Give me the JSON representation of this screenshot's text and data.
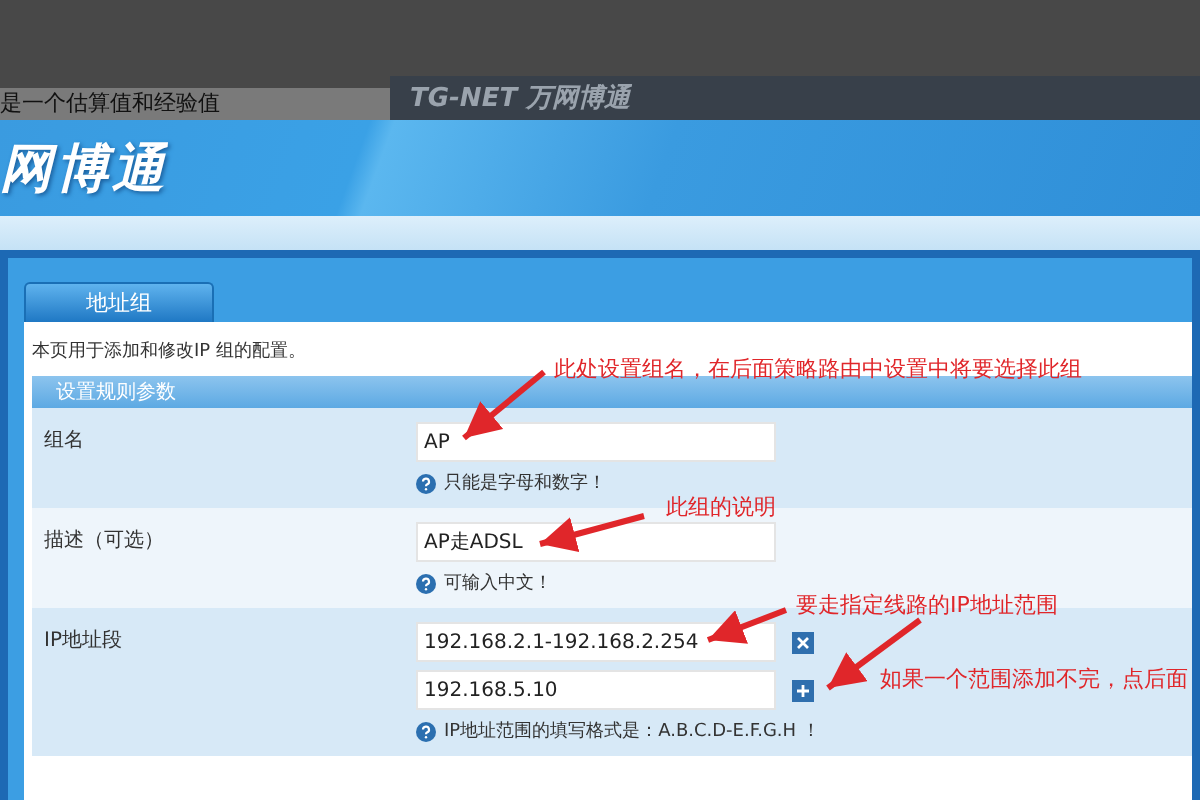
{
  "top_bar": {
    "caption": "是一个估算值和经验值",
    "brand": "TG-NET 万网博通"
  },
  "header": {
    "logo": "网博通"
  },
  "tabs": [
    {
      "label": "地址组",
      "selected": true
    }
  ],
  "description": "本页用于添加和修改IP 组的配置。",
  "section": {
    "title": "设置规则参数"
  },
  "rows": [
    {
      "label": "组名",
      "fields": [
        {
          "value": "AP"
        }
      ],
      "hint": "只能是字母和数字！"
    },
    {
      "label": "描述（可选）",
      "fields": [
        {
          "value": "AP走ADSL"
        }
      ],
      "hint": "可输入中文！"
    },
    {
      "label": "IP地址段",
      "fields": [
        {
          "value": "192.168.2.1-192.168.2.254",
          "kind": "removable"
        },
        {
          "value": "192.168.5.10",
          "kind": "addable"
        }
      ],
      "hint": "IP地址范围的填写格式是：A.B.C.D-E.F.G.H ！"
    }
  ],
  "annotations": [
    "此处设置组名，在后面策略路由中设置中将要选择此组",
    "此组的说明",
    "要走指定线路的IP地址范围",
    "如果一个范围添加不完，点后面"
  ]
}
